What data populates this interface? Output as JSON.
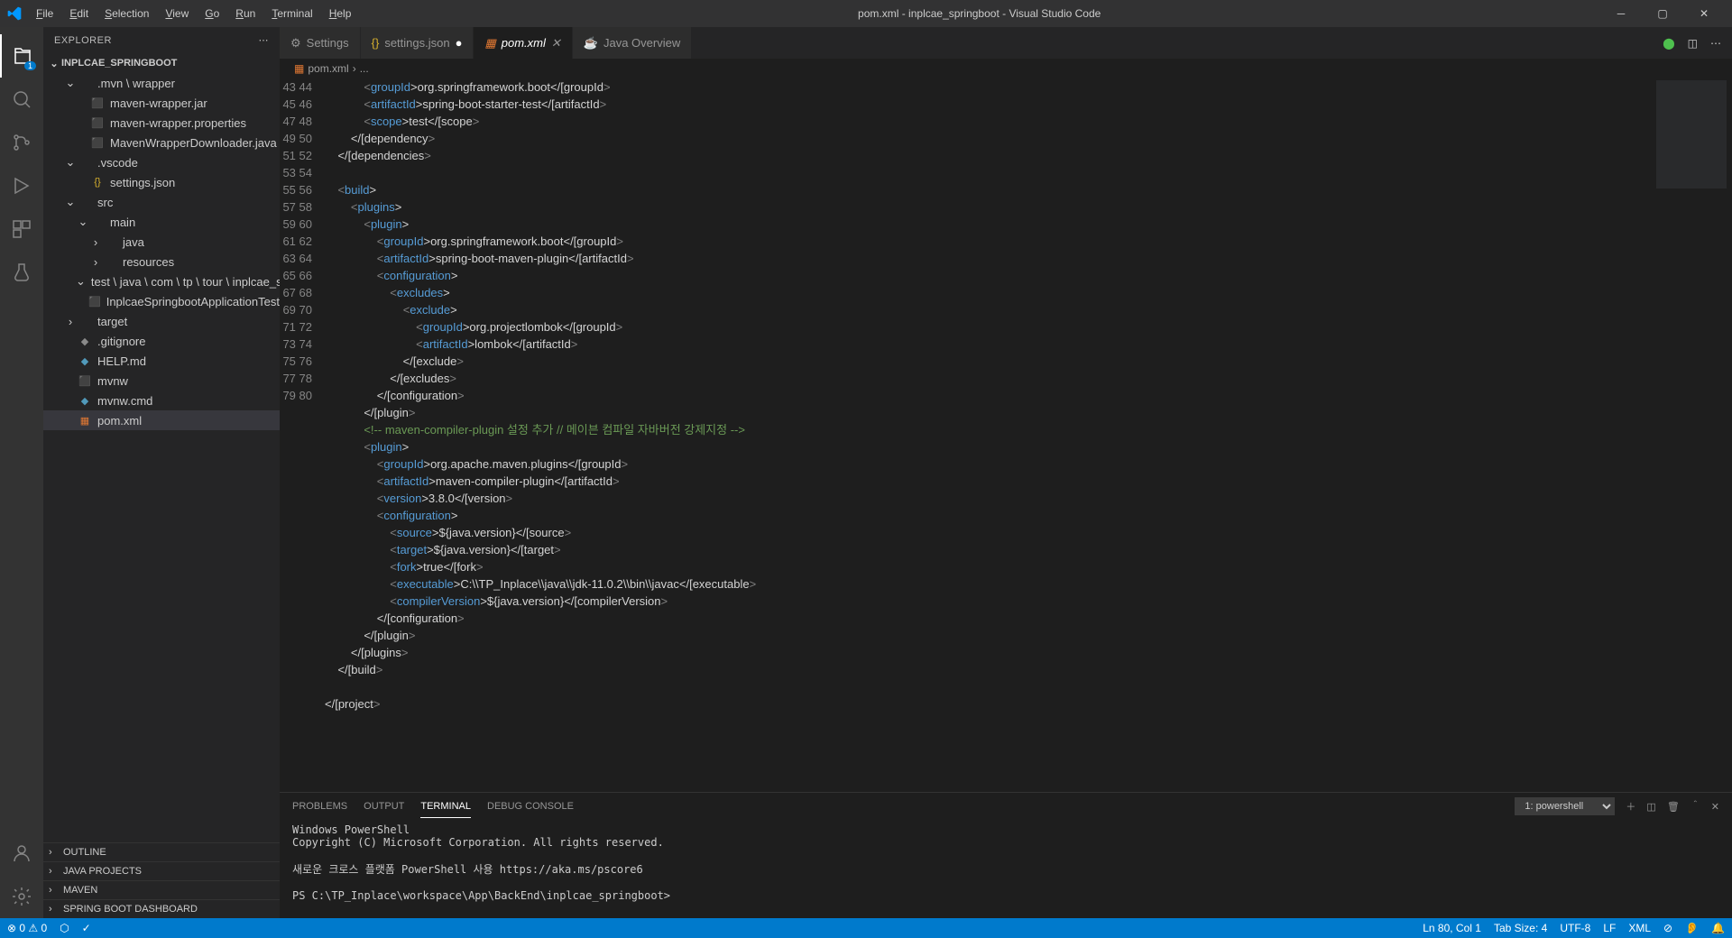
{
  "title": "pom.xml - inplcae_springboot - Visual Studio Code",
  "menus": [
    "File",
    "Edit",
    "Selection",
    "View",
    "Go",
    "Run",
    "Terminal",
    "Help"
  ],
  "explorer": {
    "title": "EXPLORER",
    "project": "INPLCAE_SPRINGBOOT",
    "tree": [
      {
        "d": 1,
        "open": true,
        "icon": "",
        "label": ".mvn \\ wrapper"
      },
      {
        "d": 2,
        "icon": "red",
        "label": "maven-wrapper.jar"
      },
      {
        "d": 2,
        "icon": "red",
        "label": "maven-wrapper.properties"
      },
      {
        "d": 2,
        "icon": "red",
        "label": "MavenWrapperDownloader.java"
      },
      {
        "d": 1,
        "open": true,
        "icon": "",
        "label": ".vscode"
      },
      {
        "d": 2,
        "icon": "yellow",
        "label": "settings.json"
      },
      {
        "d": 1,
        "open": true,
        "icon": "",
        "label": "src"
      },
      {
        "d": 2,
        "open": true,
        "icon": "",
        "label": "main"
      },
      {
        "d": 3,
        "open": false,
        "icon": "",
        "label": "java"
      },
      {
        "d": 3,
        "open": false,
        "icon": "",
        "label": "resources"
      },
      {
        "d": 2,
        "open": true,
        "icon": "",
        "label": "test \\ java \\ com \\ tp \\ tour \\ inplcae_springboot"
      },
      {
        "d": 3,
        "icon": "red",
        "label": "InplcaeSpringbootApplicationTests.java"
      },
      {
        "d": 1,
        "open": false,
        "icon": "",
        "label": "target"
      },
      {
        "d": 1,
        "icon": "gray",
        "label": ".gitignore"
      },
      {
        "d": 1,
        "icon": "blue",
        "label": "HELP.md"
      },
      {
        "d": 1,
        "icon": "red",
        "label": "mvnw"
      },
      {
        "d": 1,
        "icon": "blue",
        "label": "mvnw.cmd"
      },
      {
        "d": 1,
        "icon": "orange",
        "label": "pom.xml",
        "selected": true
      }
    ],
    "bottomPanels": [
      "OUTLINE",
      "JAVA PROJECTS",
      "MAVEN",
      "SPRING BOOT DASHBOARD"
    ]
  },
  "tabs": [
    {
      "icon": "gear",
      "label": "Settings",
      "dirty": false
    },
    {
      "icon": "yellow",
      "label": "settings.json",
      "dirty": true
    },
    {
      "icon": "orange",
      "label": "pom.xml",
      "active": true,
      "close": true
    },
    {
      "icon": "java",
      "label": "Java Overview"
    }
  ],
  "breadcrumb": {
    "file": "pom.xml",
    "sep": "›",
    "rest": "..."
  },
  "code": {
    "start": 43,
    "lines": [
      "            <[groupId]>org.springframework.boot</[groupId]>",
      "            <[artifactId]>spring-boot-starter-test</[artifactId]>",
      "            <[scope]>test</[scope]>",
      "        </[dependency]>",
      "    </[dependencies]>",
      "",
      "    <[build]>",
      "        <[plugins]>",
      "            <[plugin]>",
      "                <[groupId]>org.springframework.boot</[groupId]>",
      "                <[artifactId]>spring-boot-maven-plugin</[artifactId]>",
      "                <[configuration]>",
      "                    <[excludes]>",
      "                        <[exclude]>",
      "                            <[groupId]>org.projectlombok</[groupId]>",
      "                            <[artifactId]>lombok</[artifactId]>",
      "                        </[exclude]>",
      "                    </[excludes]>",
      "                </[configuration]>",
      "            </[plugin]>",
      "            {!-- maven-compiler-plugin 설정 추가 // 메이븐 컴파일 자바버전 강제지정 --}",
      "            <[plugin]>",
      "                <[groupId]>org.apache.maven.plugins</[groupId]>",
      "                <[artifactId]>maven-compiler-plugin</[artifactId]>",
      "                <[version]>3.8.0</[version]>",
      "                <[configuration]>",
      "                    <[source]>${java.version}</[source]>",
      "                    <[target]>${java.version}</[target]>",
      "                    <[fork]>true</[fork]>",
      "                    <[executable]>C:\\\\TP_Inplace\\\\java\\\\jdk-11.0.2\\\\bin\\\\javac</[executable]>",
      "                    <[compilerVersion]>${java.version}</[compilerVersion]>",
      "                </[configuration]>",
      "            </[plugin]>",
      "        </[plugins]>",
      "    </[build]>",
      "",
      "</[project]>",
      ""
    ]
  },
  "panel": {
    "tabs": [
      "PROBLEMS",
      "OUTPUT",
      "TERMINAL",
      "DEBUG CONSOLE"
    ],
    "active": "TERMINAL",
    "shell": "1: powershell",
    "text": "Windows PowerShell\nCopyright (C) Microsoft Corporation. All rights reserved.\n\n새로운 크로스 플랫폼 PowerShell 사용 https://aka.ms/pscore6\n\nPS C:\\TP_Inplace\\workspace\\App\\BackEnd\\inplcae_springboot>"
  },
  "status": {
    "left": [
      "⊗ 0 ⚠ 0",
      "⬡",
      "✓"
    ],
    "right": [
      "Ln 80, Col 1",
      "Tab Size: 4",
      "UTF-8",
      "LF",
      "XML",
      "⊘",
      "👂",
      "🔔"
    ]
  }
}
